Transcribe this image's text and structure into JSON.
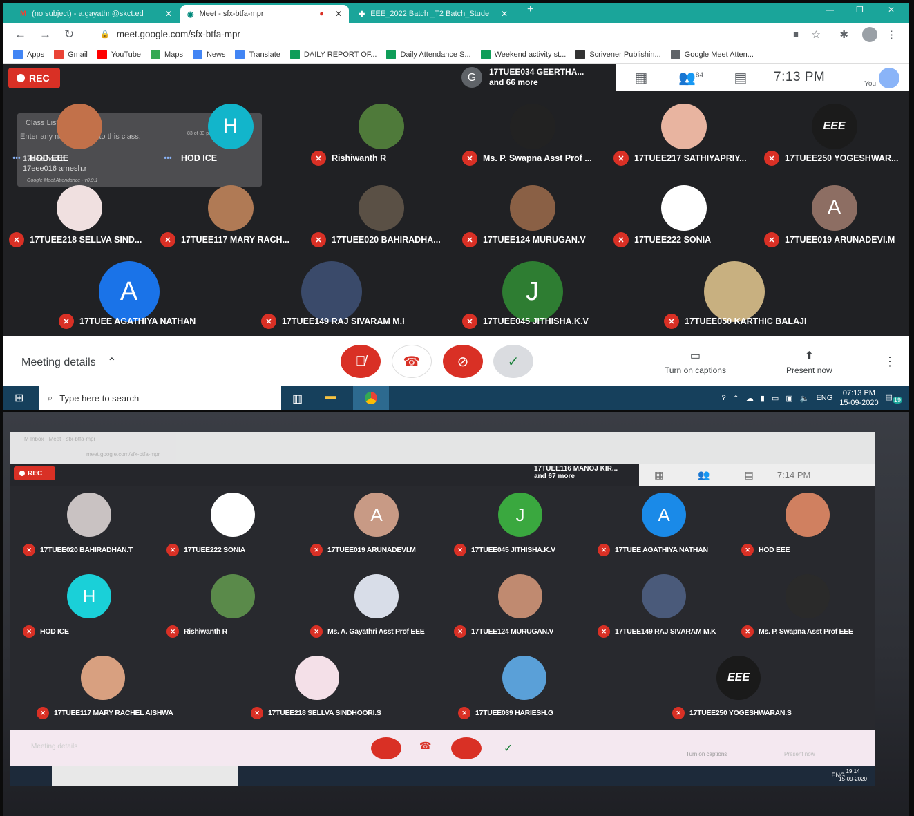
{
  "browser": {
    "tabs": [
      {
        "title": "(no subject) - a.gayathri@skct.ed",
        "icon": "gmail-icon"
      },
      {
        "title": "Meet - sfx-btfa-mpr",
        "icon": "meet-icon"
      },
      {
        "title": "EEE_2022 Batch _T2 Batch_Stude",
        "icon": "sheets-icon"
      }
    ],
    "url": "meet.google.com/sfx-btfa-mpr",
    "bookmarks": [
      {
        "label": "Apps",
        "color": "#4285f4"
      },
      {
        "label": "Gmail",
        "color": "#ea4335"
      },
      {
        "label": "YouTube",
        "color": "#ff0000"
      },
      {
        "label": "Maps",
        "color": "#34a853"
      },
      {
        "label": "News",
        "color": "#4285f4"
      },
      {
        "label": "Translate",
        "color": "#4285f4"
      },
      {
        "label": "DAILY REPORT OF...",
        "color": "#0f9d58"
      },
      {
        "label": "Daily Attendance S...",
        "color": "#0f9d58"
      },
      {
        "label": "Weekend activity st...",
        "color": "#0f9d58"
      },
      {
        "label": "Scrivener Publishin...",
        "color": "#333333"
      },
      {
        "label": "Google Meet Atten...",
        "color": "#5f6368"
      }
    ]
  },
  "meet": {
    "rec_label": "REC",
    "presenter_initial": "G",
    "presenter_name": "17TUEE034 GEERTHA...",
    "presenter_more": "and 66 more",
    "people_count": "84",
    "time": "7:13 PM",
    "you_label": "You",
    "class_list": {
      "title": "Class List",
      "placeholder": "Enter any note specific to this class.",
      "line1": "17eee hod b",
      "line2": "17eee016 arnesh.r",
      "footer": "Google Meet Attendance - v0.9.1",
      "count": "83 of 83 participants"
    },
    "participants": [
      {
        "name": "HOD EEE",
        "initial": "",
        "color": "#c2714a",
        "speaking": true
      },
      {
        "name": "HOD ICE",
        "initial": "H",
        "color": "#12b5cb",
        "speaking": true
      },
      {
        "name": "Rishiwanth R",
        "initial": "",
        "color": "#4f7a3a"
      },
      {
        "name": "Ms. P. Swapna Asst Prof ...",
        "initial": "",
        "color": "#222222"
      },
      {
        "name": "17TUEE217 SATHIYAPRIY...",
        "initial": "",
        "color": "#e8b4a0"
      },
      {
        "name": "17TUEE250 YOGESHWAR...",
        "initial": "EEE",
        "color": "#1b1b1b"
      },
      {
        "name": "17TUEE218 SELLVA SIND...",
        "initial": "",
        "color": "#f0e0e0"
      },
      {
        "name": "17TUEE117 MARY RACH...",
        "initial": "",
        "color": "#b07a55"
      },
      {
        "name": "17TUEE020 BAHIRADHA...",
        "initial": "",
        "color": "#5a5045"
      },
      {
        "name": "17TUEE124 MURUGAN.V",
        "initial": "",
        "color": "#8a6045"
      },
      {
        "name": "17TUEE222 SONIA",
        "initial": "",
        "color": "#ffffff"
      },
      {
        "name": "17TUEE019 ARUNADEVI.M",
        "initial": "A",
        "color": "#8d6e63"
      },
      {
        "name": "17TUEE AGATHIYA NATHAN",
        "initial": "A",
        "color": "#1a73e8"
      },
      {
        "name": "17TUEE149 RAJ SIVARAM M.K",
        "initial": "",
        "color": "#3a4a6a"
      },
      {
        "name": "17TUEE045 JITHISHA.K.V",
        "initial": "J",
        "color": "#2e7d32"
      },
      {
        "name": "17TUEE050 KARTHIC BALAJI",
        "initial": "",
        "color": "#c8b080"
      }
    ],
    "meeting_details": "Meeting details",
    "captions": "Turn on captions",
    "present": "Present now"
  },
  "taskbar": {
    "search_placeholder": "Type here to search",
    "lang": "ENG",
    "clock_time": "07:13 PM",
    "clock_date": "15-09-2020",
    "notif": "19"
  },
  "photo": {
    "rec_label": "REC",
    "presenter_name": "17TUEE116 MANOJ KIR...",
    "presenter_more": "and 67 more",
    "time": "7:14 PM",
    "participants": [
      {
        "name": "17TUEE020 BAHIRADHAN.T",
        "initial": "",
        "color": "#c9c2c2"
      },
      {
        "name": "17TUEE222 SONIA",
        "initial": "",
        "color": "#ffffff"
      },
      {
        "name": "17TUEE019 ARUNADEVI.M",
        "initial": "A",
        "color": "#c89a85"
      },
      {
        "name": "17TUEE045 JITHISHA.K.V",
        "initial": "J",
        "color": "#3aa83f"
      },
      {
        "name": "17TUEE AGATHIYA NATHAN",
        "initial": "A",
        "color": "#1a8ae8"
      },
      {
        "name": "HOD EEE",
        "initial": "",
        "color": "#d08060"
      },
      {
        "name": "HOD ICE",
        "initial": "H",
        "color": "#1ad0d8"
      },
      {
        "name": "Rishiwanth R",
        "initial": "",
        "color": "#5a8a4a"
      },
      {
        "name": "Ms. A. Gayathri Asst Prof EEE",
        "initial": "",
        "color": "#d8dde8"
      },
      {
        "name": "17TUEE124 MURUGAN.V",
        "initial": "",
        "color": "#c08a70"
      },
      {
        "name": "17TUEE149 RAJ SIVARAM M.K",
        "initial": "",
        "color": "#4a5a7a"
      },
      {
        "name": "Ms. P. Swapna Asst Prof EEE",
        "initial": "",
        "color": "#2a2a2a"
      },
      {
        "name": "17TUEE117 MARY RACHEL AISHWARYA.M",
        "initial": "",
        "color": "#d8a080"
      },
      {
        "name": "17TUEE218 SELLVA SINDHOORI.S",
        "initial": "",
        "color": "#f4e0e8"
      },
      {
        "name": "17TUEE039 HARIESH.G",
        "initial": "",
        "color": "#5aa0d8"
      },
      {
        "name": "17TUEE250 YOGESHWARAN.S",
        "initial": "EEE",
        "color": "#1a1a1a"
      }
    ],
    "meeting_details": "Meeting details",
    "captions": "Turn on captions",
    "present": "Present now",
    "lang": "ENG",
    "clock_time": "19:14",
    "clock_date": "15-09-2020"
  }
}
